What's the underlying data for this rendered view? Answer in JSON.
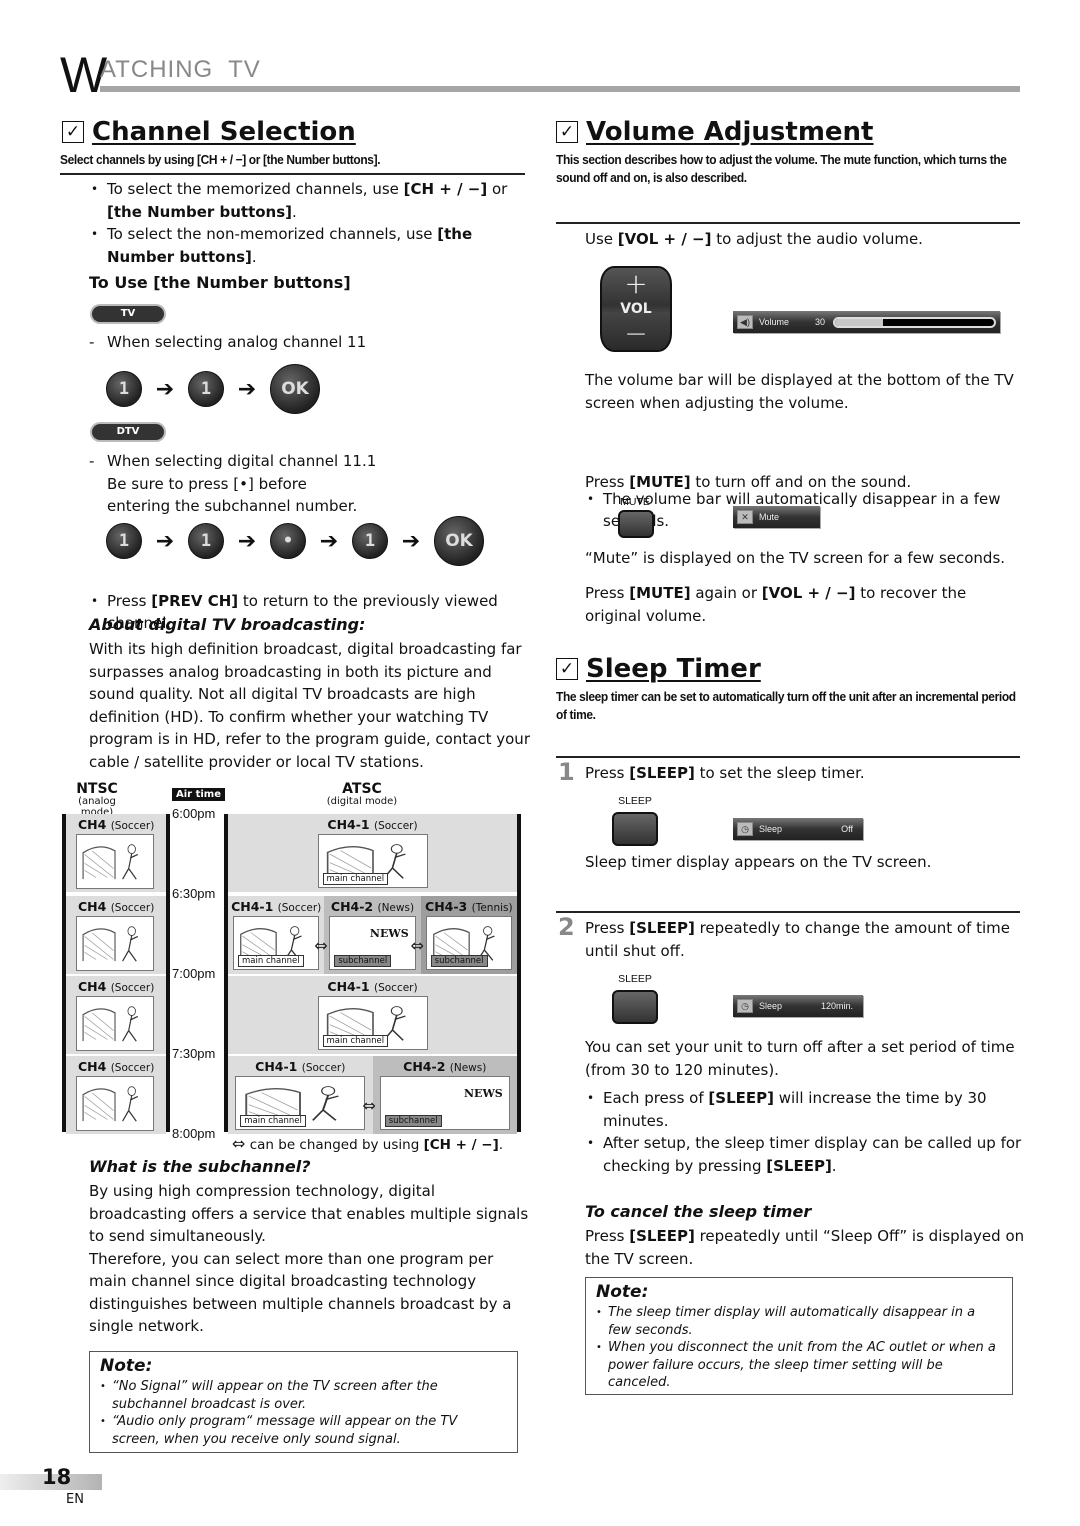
{
  "header": {
    "first_letter": "W",
    "rest": "ATCHING  TV"
  },
  "channel_selection": {
    "title": "Channel Selection",
    "subtitle": "Select channels by using [CH + / −] or [the Number buttons].",
    "bullets": [
      {
        "pre": "To select the memorized channels, use ",
        "bold1": "[CH + / −]",
        "mid": " or ",
        "bold2": "[the Number buttons]",
        "post": "."
      },
      {
        "pre": "To select the non-memorized channels, use ",
        "bold1": "[the Number buttons]",
        "post": "."
      }
    ],
    "number_buttons": {
      "heading": "To Use [the Number buttons]",
      "tv_pill": "TV",
      "tv_step": "When selecting analog channel 11",
      "tv_sequence": [
        "1",
        "1",
        "OK"
      ],
      "dtv_pill": "DTV",
      "dtv_step_lines": [
        "When selecting digital channel 11.1",
        "Be sure to press [•] before",
        "entering the subchannel number."
      ],
      "dtv_sequence": [
        "1",
        "1",
        "•",
        "1",
        "OK"
      ]
    },
    "prev_ch": {
      "pre": "Press ",
      "bold": "[PREV CH]",
      "post": " to return to the previously viewed channel."
    },
    "about_digital": {
      "heading": "About digital TV broadcasting:",
      "text": "With its high definition broadcast, digital broadcasting far surpasses analog broadcasting in both its picture and sound quality. Not all digital TV broadcasts are high definition (HD). To confirm whether your watching TV program is in HD, refer to the program guide, contact your cable / satellite provider or local TV stations."
    },
    "diagram": {
      "ntsc_label": "NTSC",
      "ntsc_sub": "(analog mode)",
      "airtime_label": "Air time",
      "atsc_label": "ATSC",
      "atsc_sub": "(digital mode)",
      "times": [
        "6:00pm",
        "6:30pm",
        "7:00pm",
        "7:30pm",
        "8:00pm"
      ],
      "ntsc_rows": [
        {
          "ch": "CH4",
          "prog": "(Soccer)"
        },
        {
          "ch": "CH4",
          "prog": "(Soccer)"
        },
        {
          "ch": "CH4",
          "prog": "(Soccer)"
        },
        {
          "ch": "CH4",
          "prog": "(Soccer)"
        }
      ],
      "atsc_rows": [
        [
          {
            "ch": "CH4-1",
            "prog": "(Soccer)",
            "tag": "main channel"
          }
        ],
        [
          {
            "ch": "CH4-1",
            "prog": "(Soccer)",
            "tag": "main channel"
          },
          {
            "ch": "CH4-2",
            "prog": "(News)",
            "tag": "subchannel"
          },
          {
            "ch": "CH4-3",
            "prog": "(Tennis)",
            "tag": "subchannel"
          }
        ],
        [
          {
            "ch": "CH4-1",
            "prog": "(Soccer)",
            "tag": "main channel"
          }
        ],
        [
          {
            "ch": "CH4-1",
            "prog": "(Soccer)",
            "tag": "main channel"
          },
          {
            "ch": "CH4-2",
            "prog": "(News)",
            "tag": "subchannel"
          }
        ]
      ],
      "news_word": "NEWS",
      "legend_text": "can be changed by using ",
      "legend_bold": "[CH + / −]",
      "legend_end": "."
    },
    "subchannel": {
      "heading": "What is the subchannel?",
      "text1": "By using high compression technology, digital broadcasting offers a service that enables multiple signals to send simultaneously.",
      "text2": "Therefore, you can select more than one program per main channel since digital broadcasting technology distinguishes between multiple channels broadcast by a single network."
    },
    "note": {
      "title": "Note:",
      "items": [
        "“No Signal” will appear on the TV screen after the subchannel broadcast is over.",
        "“Audio only program“ message will appear on the TV screen, when you receive only sound signal."
      ]
    }
  },
  "volume": {
    "title": "Volume Adjustment",
    "subtitle": "This section describes how to adjust the volume. The mute function, which turns the sound off and on, is also described.",
    "use": {
      "pre": "Use ",
      "bold": "[VOL + / −]",
      "post": " to adjust the audio volume."
    },
    "vol_button": {
      "plus": "+",
      "label": "VOL",
      "minus": "−"
    },
    "osd": {
      "label": "Volume",
      "value": "30",
      "fill_percent": 30
    },
    "bar_text": "The volume bar will be displayed at the bottom of the TV screen when adjusting the volume.",
    "bar_bullet": "The volume bar will automatically disappear in a few seconds.",
    "mute": {
      "pre": "Press ",
      "bold": "[MUTE]",
      "post": " to turn off and on the sound.",
      "button_caption": "MUTE",
      "osd_label": "Mute"
    },
    "mute_info": "“Mute” is displayed on the TV screen for a few seconds.",
    "recover": {
      "pre": "Press ",
      "bold1": "[MUTE]",
      "mid": " again or ",
      "bold2": "[VOL + / −]",
      "post": " to recover the original volume."
    }
  },
  "sleep": {
    "title": "Sleep Timer",
    "subtitle": "The sleep timer can be set to automatically turn off the unit after an incremental period of time.",
    "step1": {
      "num": "1",
      "pre": "Press ",
      "bold": "[SLEEP]",
      "post": " to set the sleep timer.",
      "button_caption": "SLEEP",
      "osd_label": "Sleep",
      "osd_value": "Off",
      "after": "Sleep timer display appears on the TV screen."
    },
    "step2": {
      "num": "2",
      "pre": "Press ",
      "bold": "[SLEEP]",
      "post": " repeatedly to change the amount of time until shut off.",
      "button_caption": "SLEEP",
      "osd_label": "Sleep",
      "osd_value": "120min.",
      "after": "You can set your unit to turn off after a set period of time (from 30 to 120 minutes)."
    },
    "bullets": [
      {
        "pre": "Each press of ",
        "bold": "[SLEEP]",
        "post": " will increase the time by 30 minutes."
      },
      {
        "pre": "After setup, the sleep timer display can be called up for checking by pressing ",
        "bold": "[SLEEP]",
        "post": "."
      }
    ],
    "cancel": {
      "heading": "To cancel the sleep timer",
      "pre": "Press ",
      "bold": "[SLEEP]",
      "post": " repeatedly until “Sleep Off” is displayed on the TV screen."
    },
    "note": {
      "title": "Note:",
      "items": [
        "The sleep timer display will automatically disappear in a few seconds.",
        "When you disconnect the unit from the AC outlet or when a power failure occurs, the sleep timer setting will be canceled."
      ]
    }
  },
  "footer": {
    "page": "18",
    "lang": "EN"
  }
}
